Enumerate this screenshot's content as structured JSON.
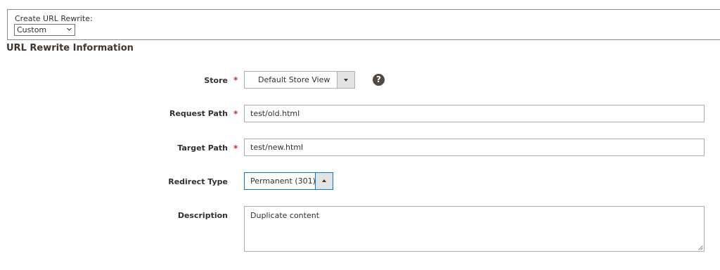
{
  "create_rewrite": {
    "label": "Create URL Rewrite:",
    "selected": "Custom"
  },
  "section": {
    "title": "URL Rewrite Information"
  },
  "fields": {
    "store": {
      "label": "Store",
      "required_mark": "*",
      "value": "Default Store View"
    },
    "request_path": {
      "label": "Request Path",
      "required_mark": "*",
      "value": "test/old.html"
    },
    "target_path": {
      "label": "Target Path",
      "required_mark": "*",
      "value": "test/new.html"
    },
    "redirect_type": {
      "label": "Redirect Type",
      "value": "Permanent (301)"
    },
    "description": {
      "label": "Description",
      "value": "Duplicate content"
    }
  },
  "help": {
    "glyph": "?"
  },
  "colors": {
    "required": "#e22626",
    "active_border": "#007bdb",
    "help_bg": "#514943"
  }
}
